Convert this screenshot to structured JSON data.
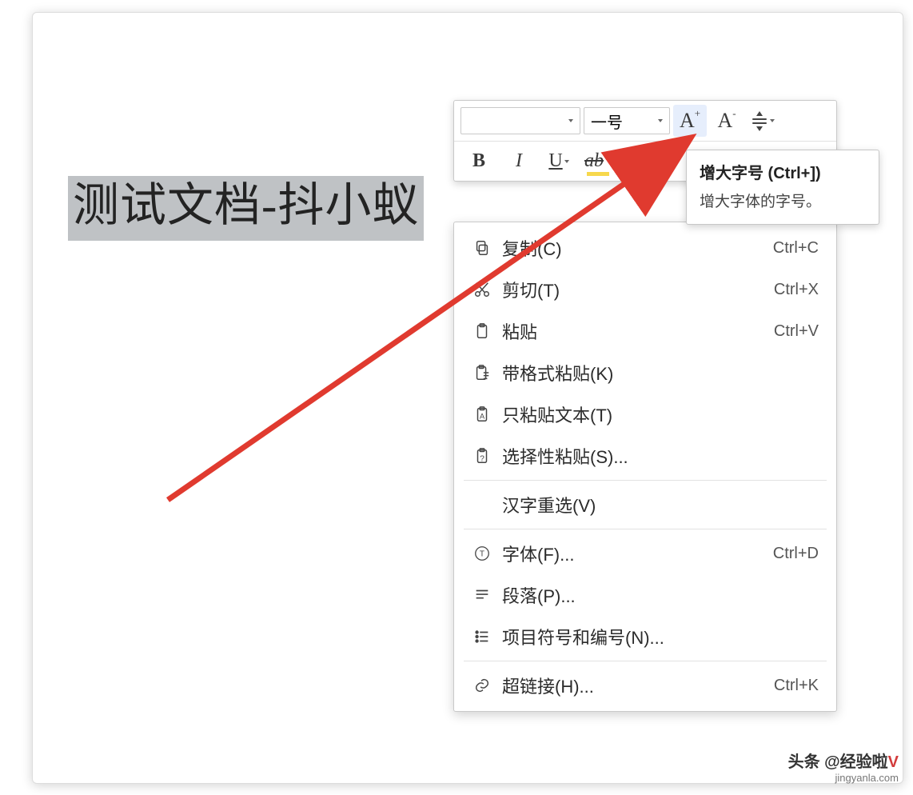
{
  "document": {
    "selected_text": "测试文档-抖小蚁"
  },
  "mini_toolbar": {
    "font_name": "",
    "font_size": "一号",
    "increase_font": "A",
    "increase_sup": "+",
    "decrease_font": "A",
    "decrease_sup": "-",
    "bold": "B",
    "italic": "I",
    "underline": "U",
    "highlight": "ab"
  },
  "tooltip": {
    "title": "增大字号 (Ctrl+])",
    "desc": "增大字体的字号。"
  },
  "context_menu": {
    "items": [
      {
        "icon": "copy",
        "label": "复制(C)",
        "shortcut": "Ctrl+C"
      },
      {
        "icon": "cut",
        "label": "剪切(T)",
        "shortcut": "Ctrl+X"
      },
      {
        "icon": "paste",
        "label": "粘贴",
        "shortcut": "Ctrl+V"
      },
      {
        "icon": "paste-format",
        "label": "带格式粘贴(K)",
        "shortcut": ""
      },
      {
        "icon": "paste-text",
        "label": "只粘贴文本(T)",
        "shortcut": ""
      },
      {
        "icon": "paste-special",
        "label": "选择性粘贴(S)...",
        "shortcut": ""
      },
      {
        "icon": "",
        "label": "汉字重选(V)",
        "shortcut": ""
      },
      {
        "icon": "font",
        "label": "字体(F)...",
        "shortcut": "Ctrl+D"
      },
      {
        "icon": "paragraph",
        "label": "段落(P)...",
        "shortcut": ""
      },
      {
        "icon": "list",
        "label": "项目符号和编号(N)...",
        "shortcut": ""
      },
      {
        "icon": "link",
        "label": "超链接(H)...",
        "shortcut": "Ctrl+K"
      }
    ]
  },
  "watermark": {
    "line1_a": "头条 @",
    "line1_b": "经验啦",
    "line1_c": "V",
    "line2": "jingyanla.com"
  }
}
